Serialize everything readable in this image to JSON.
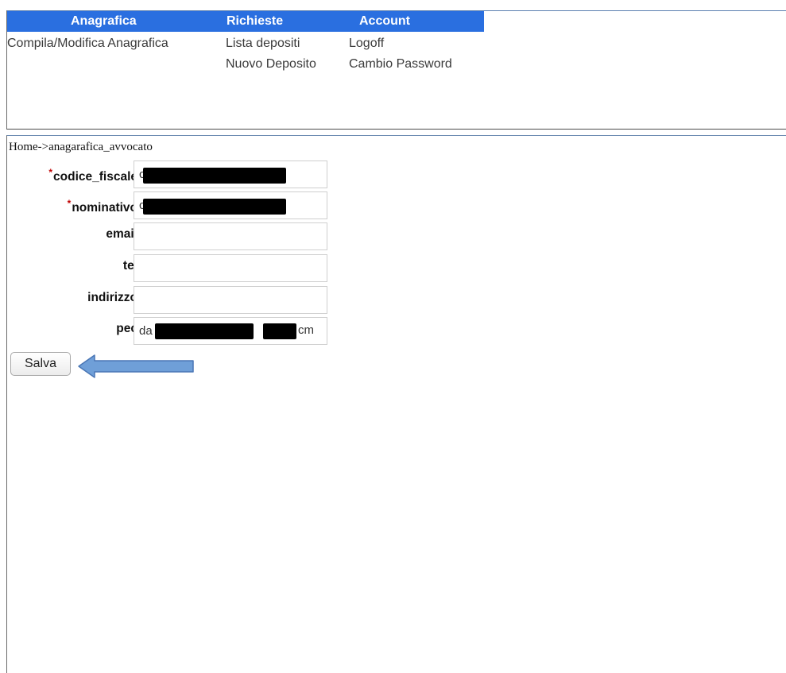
{
  "menu": {
    "headers": [
      "Anagrafica",
      "Richieste",
      "Account"
    ],
    "anagrafica": {
      "items": [
        "Compila/Modifica Anagrafica"
      ]
    },
    "richieste": {
      "items": [
        "Lista depositi",
        "Nuovo Deposito"
      ]
    },
    "account": {
      "items": [
        "Logoff",
        "Cambio Password"
      ]
    }
  },
  "breadcrumb": "Home->anagarafica_avvocato",
  "form": {
    "required_mark": "*",
    "fields": [
      {
        "label": "codice_fiscale",
        "value": "c",
        "required": true
      },
      {
        "label": "nominativo",
        "value": "c",
        "required": true
      },
      {
        "label": "email",
        "value": "",
        "required": false
      },
      {
        "label": "tel",
        "value": "",
        "required": false
      },
      {
        "label": "indirizzo",
        "value": "",
        "required": false
      },
      {
        "label": "pec",
        "value": "da",
        "value_end": "cm",
        "required": false
      }
    ],
    "save_label": "Salva"
  },
  "colors": {
    "menu_bar": "#2a6fe0",
    "arrow": "#6f9fd8",
    "required": "#c00000"
  }
}
